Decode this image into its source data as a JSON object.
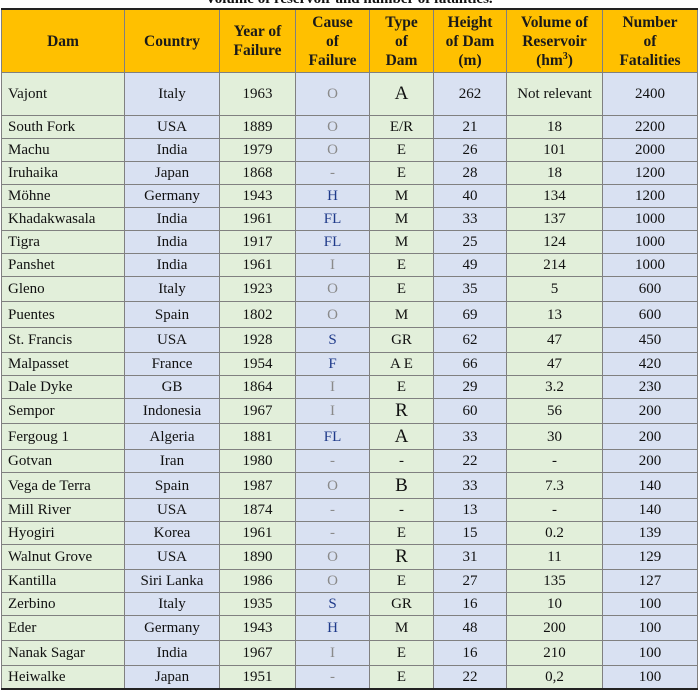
{
  "caption": "Volume of reservoir and number of fatalities.",
  "headers": {
    "dam": "Dam",
    "country": "Country",
    "year": [
      "Year of",
      "Failure"
    ],
    "cause": [
      "Cause",
      "of",
      "Failure"
    ],
    "type": [
      "Type",
      "of",
      "Dam"
    ],
    "height": [
      "Height",
      "of Dam",
      "(m)"
    ],
    "volume": [
      "Volume of",
      "Reservoir",
      "(hm",
      "3",
      ")"
    ],
    "fatalities": [
      "Number",
      "of",
      "Fatalities"
    ]
  },
  "colors": {
    "header_bg": "#ffc000",
    "green_cell": "#e2efda",
    "blue_cell": "#d9e1f2",
    "cause_gray": "#8a8a8a",
    "cause_blue": "#1f3a8a"
  },
  "rows": [
    {
      "dam": "Vajont",
      "country": "Italy",
      "year": "1963",
      "cause": "O",
      "type": "A",
      "height": "262",
      "volume": "Not relevant",
      "fatalities": "2400"
    },
    {
      "dam": "South Fork",
      "country": "USA",
      "year": "1889",
      "cause": "O",
      "type": "E/R",
      "height": "21",
      "volume": "18",
      "fatalities": "2200"
    },
    {
      "dam": "Machu",
      "country": "India",
      "year": "1979",
      "cause": "O",
      "type": "E",
      "height": "26",
      "volume": "101",
      "fatalities": "2000"
    },
    {
      "dam": "Iruhaika",
      "country": "Japan",
      "year": "1868",
      "cause": "-",
      "type": "E",
      "height": "28",
      "volume": "18",
      "fatalities": "1200"
    },
    {
      "dam": "Möhne",
      "country": "Germany",
      "year": "1943",
      "cause": "H",
      "type": "M",
      "height": "40",
      "volume": "134",
      "fatalities": "1200"
    },
    {
      "dam": "Khadakwasala",
      "country": "India",
      "year": "1961",
      "cause": "FL",
      "type": "M",
      "height": "33",
      "volume": "137",
      "fatalities": "1000"
    },
    {
      "dam": "Tigra",
      "country": "India",
      "year": "1917",
      "cause": "FL",
      "type": "M",
      "height": "25",
      "volume": "124",
      "fatalities": "1000"
    },
    {
      "dam": "Panshet",
      "country": "India",
      "year": "1961",
      "cause": "I",
      "type": "E",
      "height": "49",
      "volume": "214",
      "fatalities": "1000"
    },
    {
      "dam": "Gleno",
      "country": "Italy",
      "year": "1923",
      "cause": "O",
      "type": "E",
      "height": "35",
      "volume": "5",
      "fatalities": "600"
    },
    {
      "dam": "Puentes",
      "country": "Spain",
      "year": "1802",
      "cause": "O",
      "type": "M",
      "height": "69",
      "volume": "13",
      "fatalities": "600"
    },
    {
      "dam": "St. Francis",
      "country": "USA",
      "year": "1928",
      "cause": "S",
      "type": "GR",
      "height": "62",
      "volume": "47",
      "fatalities": "450"
    },
    {
      "dam": "Malpasset",
      "country": "France",
      "year": "1954",
      "cause": "F",
      "type": "A E",
      "height": "66",
      "volume": "47",
      "fatalities": "420"
    },
    {
      "dam": "Dale Dyke",
      "country": "GB",
      "year": "1864",
      "cause": "I",
      "type": "E",
      "height": "29",
      "volume": "3.2",
      "fatalities": "230"
    },
    {
      "dam": "Sempor",
      "country": "Indonesia",
      "year": "1967",
      "cause": "I",
      "type": "R",
      "height": "60",
      "volume": "56",
      "fatalities": "200"
    },
    {
      "dam": "Fergoug 1",
      "country": "Algeria",
      "year": "1881",
      "cause": "FL",
      "type": "A",
      "height": "33",
      "volume": "30",
      "fatalities": "200"
    },
    {
      "dam": "Gotvan",
      "country": "Iran",
      "year": "1980",
      "cause": "-",
      "type": "-",
      "height": "22",
      "volume": "-",
      "fatalities": "200"
    },
    {
      "dam": "Vega de Terra",
      "country": "Spain",
      "year": "1987",
      "cause": "O",
      "type": "B",
      "height": "33",
      "volume": "7.3",
      "fatalities": "140"
    },
    {
      "dam": "Mill River",
      "country": "USA",
      "year": "1874",
      "cause": "-",
      "type": "-",
      "height": "13",
      "volume": "-",
      "fatalities": "140"
    },
    {
      "dam": "Hyogiri",
      "country": "Korea",
      "year": "1961",
      "cause": "-",
      "type": "E",
      "height": "15",
      "volume": "0.2",
      "fatalities": "139"
    },
    {
      "dam": "Walnut Grove",
      "country": "USA",
      "year": "1890",
      "cause": "O",
      "type": "R",
      "height": "31",
      "volume": "11",
      "fatalities": "129"
    },
    {
      "dam": "Kantilla",
      "country": "Siri Lanka",
      "year": "1986",
      "cause": "O",
      "type": "E",
      "height": "27",
      "volume": "135",
      "fatalities": "127"
    },
    {
      "dam": "Zerbino",
      "country": "Italy",
      "year": "1935",
      "cause": "S",
      "type": "GR",
      "height": "16",
      "volume": "10",
      "fatalities": "100"
    },
    {
      "dam": "Eder",
      "country": "Germany",
      "year": "1943",
      "cause": "H",
      "type": "M",
      "height": "48",
      "volume": "200",
      "fatalities": "100"
    },
    {
      "dam": "Nanak Sagar",
      "country": "India",
      "year": "1967",
      "cause": "I",
      "type": "E",
      "height": "16",
      "volume": "210",
      "fatalities": "100"
    },
    {
      "dam": "Heiwalke",
      "country": "Japan",
      "year": "1951",
      "cause": "-",
      "type": "E",
      "height": "22",
      "volume": "0,2",
      "fatalities": "100"
    }
  ]
}
